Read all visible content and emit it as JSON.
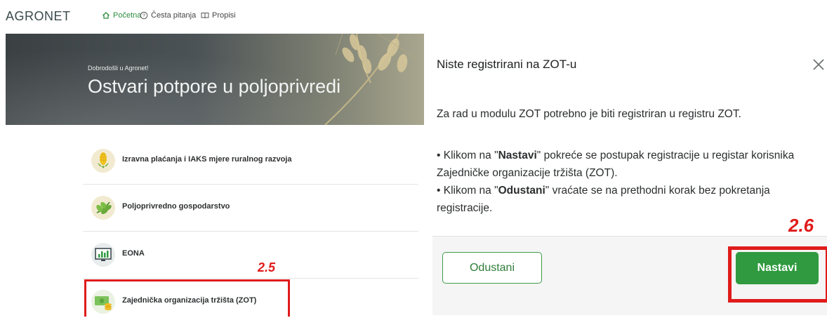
{
  "app": {
    "logo": "AGRONET"
  },
  "nav": [
    {
      "label": "Početna",
      "icon": "home-icon",
      "active": true
    },
    {
      "label": "Česta pitanja",
      "icon": "help-circle-icon",
      "active": false
    },
    {
      "label": "Propisi",
      "icon": "book-icon",
      "active": false
    }
  ],
  "hero": {
    "welcome": "Dobrodošli u Agronet!",
    "title": "Ostvari potpore u poljoprivredi"
  },
  "menu": [
    {
      "label": "Izravna plaćanja i IAKS mjere ruralnog razvoja",
      "icon": "corn-icon"
    },
    {
      "label": "Poljoprivredno gospodarstvo",
      "icon": "plant-icon"
    },
    {
      "label": "EONA",
      "icon": "monitor-chart-icon"
    },
    {
      "label": "Zajednička organizacija tržišta (ZOT)",
      "icon": "money-coins-icon"
    }
  ],
  "annotations": {
    "step_left": "2.5",
    "step_right": "2.6",
    "highlight_color": "#e01b1b"
  },
  "modal": {
    "title": "Niste registrirani na ZOT-u",
    "intro": "Za rad u modulu ZOT potrebno je biti registriran u registru ZOT.",
    "bullet1_prefix": "• Klikom na \"",
    "bullet1_bold": "Nastavi",
    "bullet1_suffix": "\" pokreće se postupak registracije u registar korisnika Zajedničke organizacije tržišta (ZOT).",
    "bullet2_prefix": "• Klikom na \"",
    "bullet2_bold": "Odustani",
    "bullet2_suffix": "\" vraćate se na prethodni korak bez pokretanja registracije.",
    "cancel_label": "Odustani",
    "continue_label": "Nastavi"
  },
  "colors": {
    "accent": "#2f9a3f",
    "annotation": "#e01b1b"
  }
}
